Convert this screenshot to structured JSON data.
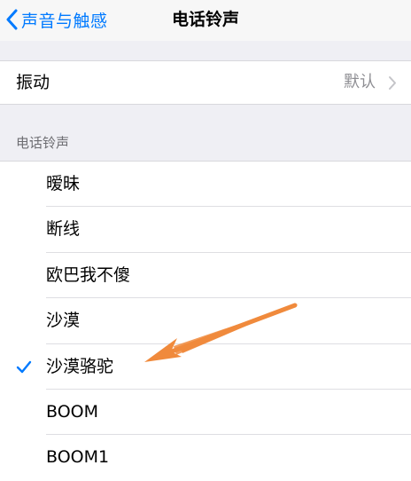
{
  "nav": {
    "back_label": "声音与触感",
    "title": "电话铃声"
  },
  "vibration": {
    "label": "振动",
    "value": "默认"
  },
  "ringtones": {
    "header": "电话铃声",
    "items": [
      {
        "label": "暧昧",
        "selected": false
      },
      {
        "label": "断线",
        "selected": false
      },
      {
        "label": "欧巴我不傻",
        "selected": false
      },
      {
        "label": "沙漠",
        "selected": false
      },
      {
        "label": "沙漠骆驼",
        "selected": true
      },
      {
        "label": "BOOM",
        "selected": false
      },
      {
        "label": "BOOM1",
        "selected": false
      }
    ]
  },
  "colors": {
    "accent": "#007aff",
    "annotation_arrow": "#f08a3c",
    "background": "#efeff4"
  }
}
